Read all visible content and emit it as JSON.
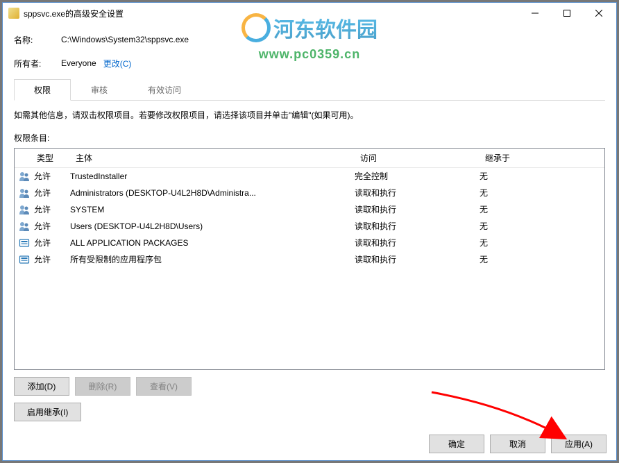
{
  "title": "sppsvc.exe的高级安全设置",
  "info": {
    "name_label": "名称:",
    "name_value": "C:\\Windows\\System32\\sppsvc.exe",
    "owner_label": "所有者:",
    "owner_value": "Everyone",
    "change_link": "更改(C)"
  },
  "tabs": {
    "permissions": "权限",
    "audit": "审核",
    "effective": "有效访问"
  },
  "instructions": "如需其他信息，请双击权限项目。若要修改权限项目，请选择该项目并单击\"编辑\"(如果可用)。",
  "entries_label": "权限条目:",
  "columns": {
    "type": "类型",
    "principal": "主体",
    "access": "访问",
    "inherit": "继承于"
  },
  "rows": [
    {
      "icon": "user",
      "type": "允许",
      "principal": "TrustedInstaller",
      "access": "完全控制",
      "inherit": "无"
    },
    {
      "icon": "group",
      "type": "允许",
      "principal": "Administrators (DESKTOP-U4L2H8D\\Administra...",
      "access": "读取和执行",
      "inherit": "无"
    },
    {
      "icon": "user",
      "type": "允许",
      "principal": "SYSTEM",
      "access": "读取和执行",
      "inherit": "无"
    },
    {
      "icon": "group",
      "type": "允许",
      "principal": "Users (DESKTOP-U4L2H8D\\Users)",
      "access": "读取和执行",
      "inherit": "无"
    },
    {
      "icon": "pkg",
      "type": "允许",
      "principal": "ALL APPLICATION PACKAGES",
      "access": "读取和执行",
      "inherit": "无"
    },
    {
      "icon": "pkg",
      "type": "允许",
      "principal": "所有受限制的应用程序包",
      "access": "读取和执行",
      "inherit": "无"
    }
  ],
  "buttons": {
    "add": "添加(D)",
    "remove": "删除(R)",
    "view": "查看(V)",
    "enable_inherit": "启用继承(I)",
    "ok": "确定",
    "cancel": "取消",
    "apply": "应用(A)"
  },
  "watermark": {
    "text": "河东软件园",
    "url": "www.pc0359.cn"
  }
}
